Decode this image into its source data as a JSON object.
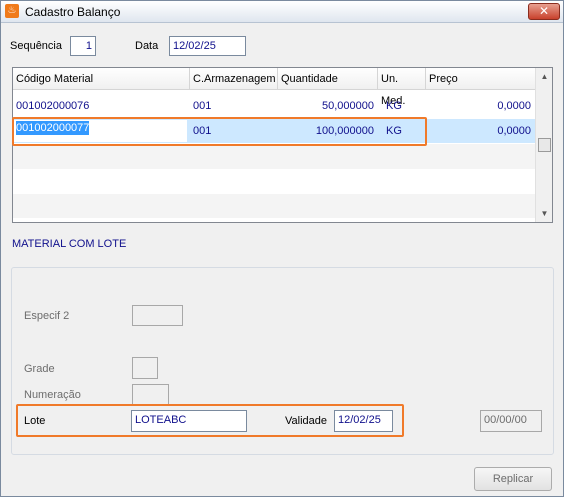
{
  "window": {
    "title": "Cadastro Balanço",
    "icon": "app-logo-icon",
    "close_glyph": "✕"
  },
  "header": {
    "sequencia_label": "Sequência",
    "sequencia_value": "1",
    "data_label": "Data",
    "data_value": "12/02/25"
  },
  "grid": {
    "columns": [
      "Código Material",
      "C.Armazenagem",
      "Quantidade",
      "Un. Med.",
      "Preço"
    ],
    "rows": [
      {
        "codigo": "001002000076",
        "armazenagem": "001",
        "quantidade": "50,000000",
        "unidade": "KG",
        "preco": "0,0000"
      },
      {
        "codigo": "001002000077",
        "armazenagem": "001",
        "quantidade": "100,000000",
        "unidade": "KG",
        "preco": "0,0000"
      }
    ],
    "scroll_up_glyph": "▲",
    "scroll_down_glyph": "▼"
  },
  "lote_section": {
    "title": "MATERIAL COM LOTE",
    "especif2_label": "Especif 2",
    "especif2_value": "",
    "grade_label": "Grade",
    "grade_value": "",
    "numeracao_label": "Numeração",
    "numeracao_value": "",
    "lote_label": "Lote",
    "lote_value": "LOTEABC",
    "validade_label": "Validade",
    "validade_value": "12/02/25",
    "extra_date_value": "00/00/00"
  },
  "buttons": {
    "replicar": "Replicar"
  },
  "colors": {
    "accent_highlight": "#f07a2a",
    "value_text": "#10108c",
    "selection": "#3399ff"
  }
}
